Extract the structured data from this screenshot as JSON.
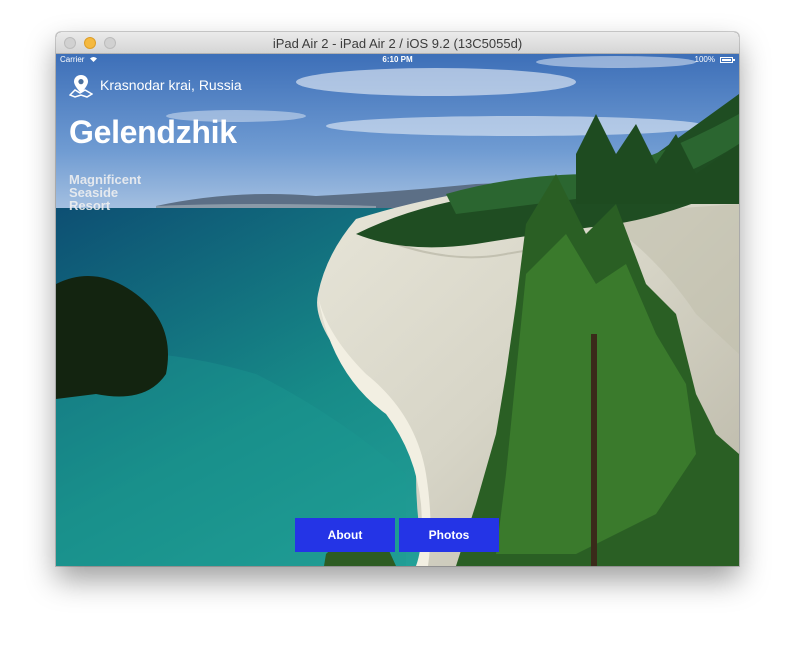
{
  "window": {
    "title": "iPad Air 2 - iPad Air 2 / iOS 9.2 (13C5055d)"
  },
  "status_bar": {
    "carrier": "Carrier",
    "time": "6:10 PM",
    "battery": "100%"
  },
  "hero": {
    "location": "Krasnodar krai, Russia",
    "city": "Gelendzhik",
    "tagline": [
      "Magnificent",
      "Seaside",
      "Resort"
    ]
  },
  "tabs": [
    {
      "label": "About"
    },
    {
      "label": "Photos"
    }
  ],
  "colors": {
    "tab_button": "#2434e6",
    "sea": "#178b88",
    "cliff": "#d7d5c7"
  },
  "icons": {
    "location": "map-pin-icon",
    "wifi": "wifi-icon",
    "battery": "battery-icon"
  }
}
